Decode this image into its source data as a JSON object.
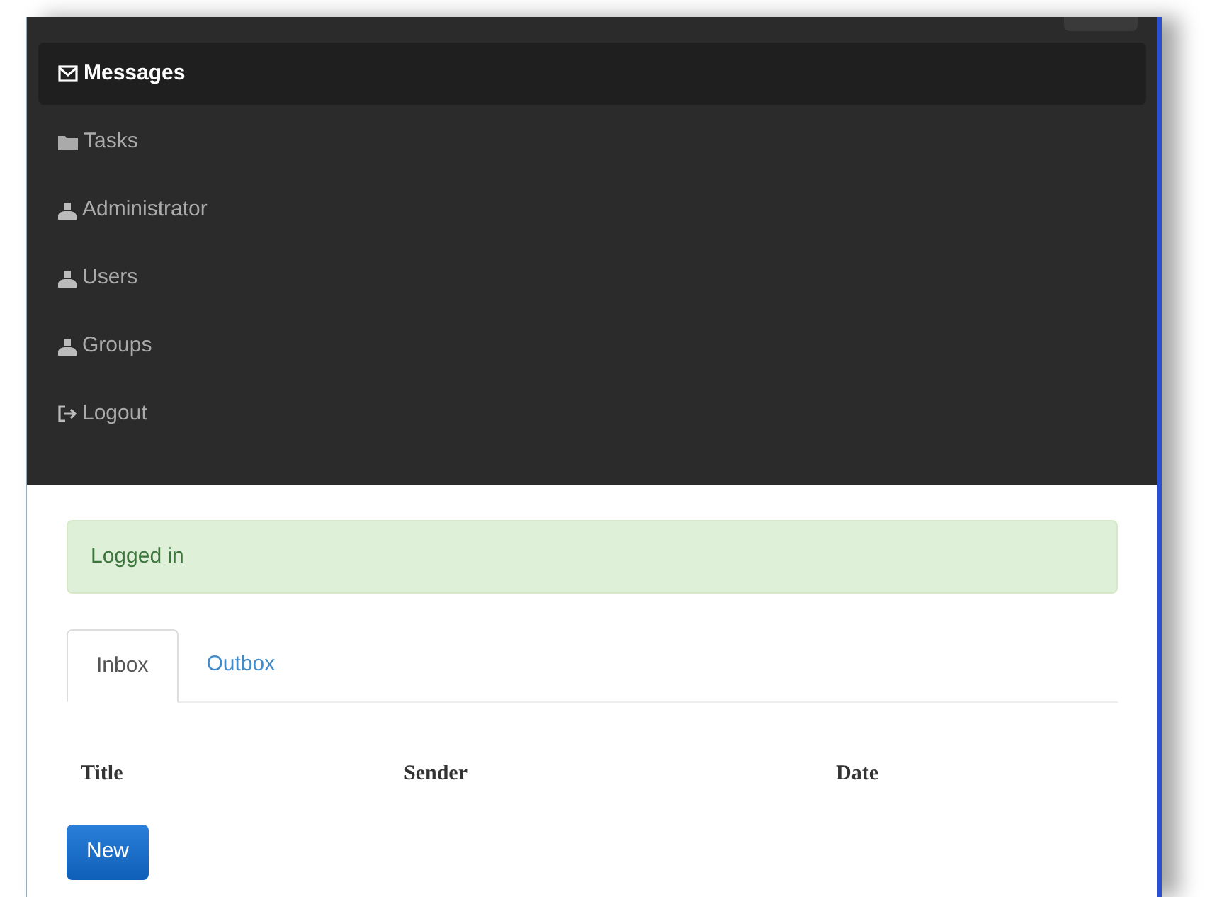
{
  "navbar": {
    "items": [
      {
        "label": "Messages",
        "kind": "envelope",
        "selected": true
      },
      {
        "label": "Tasks",
        "kind": "folder",
        "selected": false
      },
      {
        "label": "Administrator",
        "kind": "user",
        "selected": false
      },
      {
        "label": "Users",
        "kind": "user",
        "selected": false
      },
      {
        "label": "Groups",
        "kind": "user",
        "selected": false
      },
      {
        "label": "Logout",
        "kind": "logout",
        "selected": false
      }
    ]
  },
  "alert": {
    "text": "Logged in"
  },
  "tabs": [
    {
      "label": "Inbox",
      "selected": true
    },
    {
      "label": "Outbox",
      "selected": false
    }
  ],
  "table": {
    "columns": [
      "Title",
      "Sender",
      "Date"
    ]
  },
  "buttons": [
    {
      "label": "New"
    }
  ]
}
